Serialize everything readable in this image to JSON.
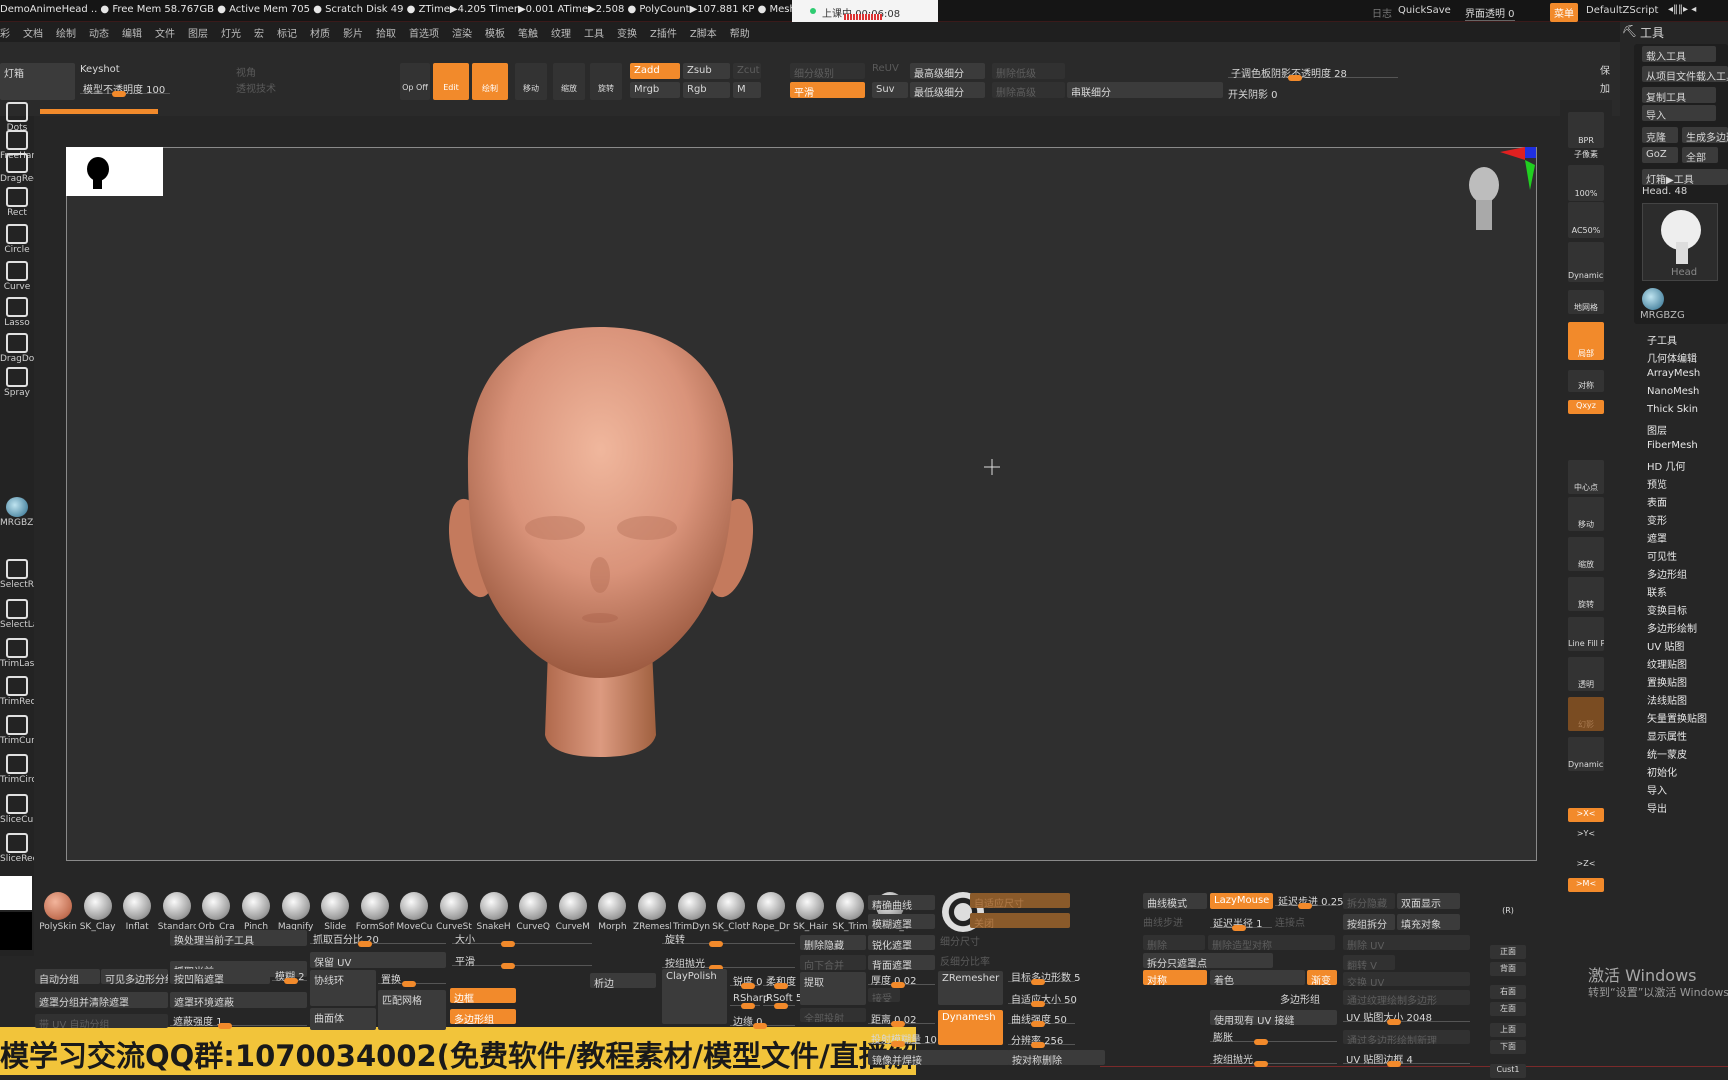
{
  "title_bar": {
    "status": "DemoAnimeHead .. ● Free Mem 58.767GB ● Active Mem 705 ● Scratch Disk 49 ● ZTime▶4.205 Timer▶0.001 ATime▶2.508 ● PolyCount▶107.881 KP ● MeshCount▶1",
    "recording_label": "上课中",
    "recording_time": "00:06:08",
    "log": "日志",
    "quicksave": "QuickSave",
    "ui_transparency": "界面透明 0",
    "menu": "菜单",
    "script": "DefaultZScript"
  },
  "menu": [
    "彩",
    "文档",
    "绘制",
    "动态",
    "编辑",
    "文件",
    "图层",
    "灯光",
    "宏",
    "标记",
    "材质",
    "影片",
    "拾取",
    "首选项",
    "渲染",
    "模板",
    "笔触",
    "纹理",
    "工具",
    "变换",
    "Z插件",
    "Z脚本",
    "帮助"
  ],
  "top_toolbar": [
    "灯箱",
    "Keyshot",
    "模型不透明度 100",
    "视角",
    "透视技术",
    "Op Off",
    "Edit",
    "绘制",
    "移动",
    "缩放",
    "旋转",
    "Zadd",
    "Zsub",
    "Zcut",
    "Mrgb",
    "Rgb",
    "M",
    "细分级别",
    "平滑",
    "ReUV",
    "Suv",
    "最高级细分",
    "最低级细分",
    "删除低级",
    "删除高级",
    "串联细分",
    "子调色板阴影不透明度 28",
    "开关阴影 0",
    "保",
    "加"
  ],
  "left_tools": [
    "Dots",
    "FreeHan",
    "DragRec",
    "Rect",
    "Circle",
    "Curve",
    "Lasso",
    "DragDot",
    "Spray",
    "MRGBZG",
    "SelectRe",
    "SelectLa",
    "TrimLas",
    "TrimRec",
    "TrimCur",
    "TrimCirc",
    "SliceCur",
    "SliceRec"
  ],
  "right_toolbar": [
    "BPR",
    "子像素",
    "100%",
    "AC50%",
    "Dynamic 透视",
    "地网格",
    "局部",
    "对称",
    "Qxyz",
    "中心点",
    "移动",
    "缩放",
    "旋转",
    "Line Fill PolyF",
    "透明",
    "幻影",
    "Dynamic 独立",
    ">X<",
    ">Y<",
    ">Z<",
    ">M<",
    "(R)",
    "正面",
    "背面",
    "右面",
    "左面",
    "上面",
    "下面",
    "Cust1"
  ],
  "tool_panel": {
    "header": "工具",
    "buttons": [
      "载入工具",
      "从项目文件载入工具",
      "复制工具",
      "导入",
      "克隆",
      "生成多边形",
      "GoZ",
      "全部",
      "灯箱▶工具"
    ],
    "current_tool": "Head. 48",
    "thumb_label": "Head",
    "material": "MRGBZG",
    "sections": [
      "子工具",
      "几何体编辑",
      "ArrayMesh",
      "NanoMesh",
      "Thick Skin",
      "图层",
      "FiberMesh",
      "HD 几何",
      "预览",
      "表面",
      "变形",
      "遮罩",
      "可见性",
      "多边形组",
      "联系",
      "变换目标",
      "多边形绘制",
      "UV 贴图",
      "纹理贴图",
      "置换贴图",
      "法线贴图",
      "矢量置换贴图",
      "显示属性",
      "统一蒙皮",
      "初始化",
      "导入",
      "导出"
    ]
  },
  "brushes": [
    "PolySkin",
    "SK_Clay",
    "Inflat",
    "Standard",
    "Orb_Cra",
    "Pinch",
    "Magnify",
    "Slide",
    "FormSoft",
    "MoveCu",
    "CurveSt",
    "SnakeH",
    "CurveQ",
    "CurveM",
    "Morph",
    "ZRemesh",
    "TrimDyn",
    "SK_Cloth",
    "Rope_Dr",
    "SK_Hair",
    "SK_Trim",
    "Chisel_f"
  ],
  "bottom_controls": [
    "换处理当前子工具",
    "抓取当前",
    "自动分组",
    "可见多边形分组",
    "按凹陷遮罩",
    "模糊 2",
    "遮罩分组并清除遮罩",
    "遮罩环境遮蔽",
    "带 UV 自动分组",
    "遮蔽强度 1",
    "抓取百分比 20",
    "保留 UV",
    "协线环",
    "置换",
    "匹配网格",
    "曲面体",
    "大小",
    "平滑",
    "边框",
    "多边形组",
    "析边",
    "旋转",
    "按组抛光",
    "ClayPolish",
    "锐度 0",
    "柔和度",
    "RSharp",
    "RSoft 5",
    "边缘 0",
    "删除隐藏",
    "向下合并",
    "提取",
    "全部投射",
    "精确曲线",
    "模糊遮罩",
    "锐化遮罩",
    "背面遮罩",
    "厚度 0.02",
    "接受",
    "距离 0.02",
    "投射模糊量 10",
    "镜像并焊接",
    "自适应尺寸",
    "关闭",
    "细分尺寸",
    "反细分比率",
    "ZRemesher",
    "Dynamesh",
    "目标多边形数 5",
    "自适应大小 50",
    "曲线强度 50",
    "分辨率 256",
    "按对称删除",
    "曲线模式",
    "曲线步进",
    "LazyMouse",
    "延迟步进 0.25",
    "延迟半径 1",
    "连接点",
    "删除",
    "删除造型对称",
    "拆分只遮罩点",
    "对称",
    "着色",
    "渐变",
    "多边形组",
    "使用现有 UV 接缝",
    "膨胀",
    "按组抛光",
    "拆分隐藏",
    "双面显示",
    "按组拆分",
    "填充对象",
    "删除 UV",
    "翻转 V",
    "交换 UV",
    "通过纹理绘制多边形",
    "UV 贴图大小 2048",
    "通过多边形绘制新理",
    "UV 贴图边框 4"
  ],
  "banner": "模学习交流QQ群:1070034002(免费软件/教程素材/模型文件/直播解答)",
  "watermark": {
    "title": "激活 Windows",
    "subtitle": "转到“设置”以激活 Windows。"
  },
  "colors": {
    "accent": "#f28a2b",
    "skin": "#d99478",
    "banner": "#f2c43a"
  }
}
